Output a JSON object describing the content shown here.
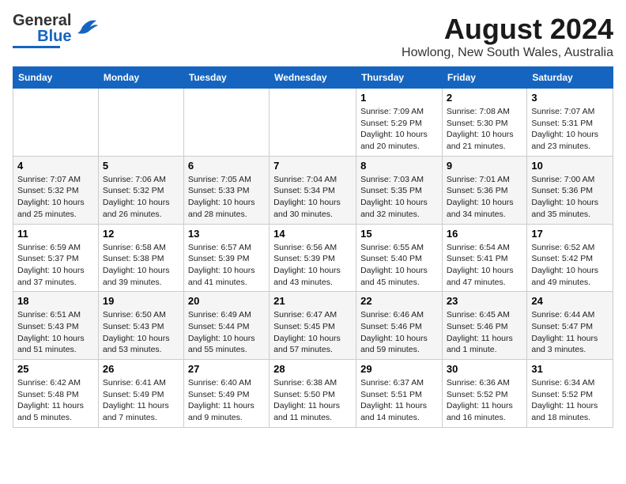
{
  "header": {
    "logo": {
      "general": "General",
      "blue": "Blue"
    },
    "title": "August 2024",
    "location": "Howlong, New South Wales, Australia"
  },
  "days_of_week": [
    "Sunday",
    "Monday",
    "Tuesday",
    "Wednesday",
    "Thursday",
    "Friday",
    "Saturday"
  ],
  "weeks": [
    [
      {
        "day": "",
        "info": ""
      },
      {
        "day": "",
        "info": ""
      },
      {
        "day": "",
        "info": ""
      },
      {
        "day": "",
        "info": ""
      },
      {
        "day": "1",
        "info": "Sunrise: 7:09 AM\nSunset: 5:29 PM\nDaylight: 10 hours\nand 20 minutes."
      },
      {
        "day": "2",
        "info": "Sunrise: 7:08 AM\nSunset: 5:30 PM\nDaylight: 10 hours\nand 21 minutes."
      },
      {
        "day": "3",
        "info": "Sunrise: 7:07 AM\nSunset: 5:31 PM\nDaylight: 10 hours\nand 23 minutes."
      }
    ],
    [
      {
        "day": "4",
        "info": "Sunrise: 7:07 AM\nSunset: 5:32 PM\nDaylight: 10 hours\nand 25 minutes."
      },
      {
        "day": "5",
        "info": "Sunrise: 7:06 AM\nSunset: 5:32 PM\nDaylight: 10 hours\nand 26 minutes."
      },
      {
        "day": "6",
        "info": "Sunrise: 7:05 AM\nSunset: 5:33 PM\nDaylight: 10 hours\nand 28 minutes."
      },
      {
        "day": "7",
        "info": "Sunrise: 7:04 AM\nSunset: 5:34 PM\nDaylight: 10 hours\nand 30 minutes."
      },
      {
        "day": "8",
        "info": "Sunrise: 7:03 AM\nSunset: 5:35 PM\nDaylight: 10 hours\nand 32 minutes."
      },
      {
        "day": "9",
        "info": "Sunrise: 7:01 AM\nSunset: 5:36 PM\nDaylight: 10 hours\nand 34 minutes."
      },
      {
        "day": "10",
        "info": "Sunrise: 7:00 AM\nSunset: 5:36 PM\nDaylight: 10 hours\nand 35 minutes."
      }
    ],
    [
      {
        "day": "11",
        "info": "Sunrise: 6:59 AM\nSunset: 5:37 PM\nDaylight: 10 hours\nand 37 minutes."
      },
      {
        "day": "12",
        "info": "Sunrise: 6:58 AM\nSunset: 5:38 PM\nDaylight: 10 hours\nand 39 minutes."
      },
      {
        "day": "13",
        "info": "Sunrise: 6:57 AM\nSunset: 5:39 PM\nDaylight: 10 hours\nand 41 minutes."
      },
      {
        "day": "14",
        "info": "Sunrise: 6:56 AM\nSunset: 5:39 PM\nDaylight: 10 hours\nand 43 minutes."
      },
      {
        "day": "15",
        "info": "Sunrise: 6:55 AM\nSunset: 5:40 PM\nDaylight: 10 hours\nand 45 minutes."
      },
      {
        "day": "16",
        "info": "Sunrise: 6:54 AM\nSunset: 5:41 PM\nDaylight: 10 hours\nand 47 minutes."
      },
      {
        "day": "17",
        "info": "Sunrise: 6:52 AM\nSunset: 5:42 PM\nDaylight: 10 hours\nand 49 minutes."
      }
    ],
    [
      {
        "day": "18",
        "info": "Sunrise: 6:51 AM\nSunset: 5:43 PM\nDaylight: 10 hours\nand 51 minutes."
      },
      {
        "day": "19",
        "info": "Sunrise: 6:50 AM\nSunset: 5:43 PM\nDaylight: 10 hours\nand 53 minutes."
      },
      {
        "day": "20",
        "info": "Sunrise: 6:49 AM\nSunset: 5:44 PM\nDaylight: 10 hours\nand 55 minutes."
      },
      {
        "day": "21",
        "info": "Sunrise: 6:47 AM\nSunset: 5:45 PM\nDaylight: 10 hours\nand 57 minutes."
      },
      {
        "day": "22",
        "info": "Sunrise: 6:46 AM\nSunset: 5:46 PM\nDaylight: 10 hours\nand 59 minutes."
      },
      {
        "day": "23",
        "info": "Sunrise: 6:45 AM\nSunset: 5:46 PM\nDaylight: 11 hours\nand 1 minute."
      },
      {
        "day": "24",
        "info": "Sunrise: 6:44 AM\nSunset: 5:47 PM\nDaylight: 11 hours\nand 3 minutes."
      }
    ],
    [
      {
        "day": "25",
        "info": "Sunrise: 6:42 AM\nSunset: 5:48 PM\nDaylight: 11 hours\nand 5 minutes."
      },
      {
        "day": "26",
        "info": "Sunrise: 6:41 AM\nSunset: 5:49 PM\nDaylight: 11 hours\nand 7 minutes."
      },
      {
        "day": "27",
        "info": "Sunrise: 6:40 AM\nSunset: 5:49 PM\nDaylight: 11 hours\nand 9 minutes."
      },
      {
        "day": "28",
        "info": "Sunrise: 6:38 AM\nSunset: 5:50 PM\nDaylight: 11 hours\nand 11 minutes."
      },
      {
        "day": "29",
        "info": "Sunrise: 6:37 AM\nSunset: 5:51 PM\nDaylight: 11 hours\nand 14 minutes."
      },
      {
        "day": "30",
        "info": "Sunrise: 6:36 AM\nSunset: 5:52 PM\nDaylight: 11 hours\nand 16 minutes."
      },
      {
        "day": "31",
        "info": "Sunrise: 6:34 AM\nSunset: 5:52 PM\nDaylight: 11 hours\nand 18 minutes."
      }
    ]
  ]
}
